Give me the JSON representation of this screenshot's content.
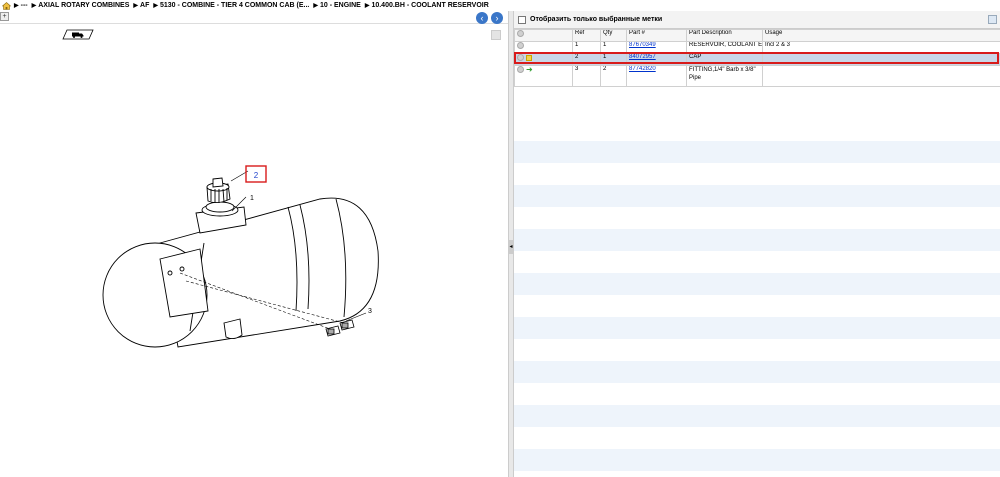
{
  "breadcrumb": {
    "items": [
      "---",
      "AXIAL ROTARY COMBINES",
      "AF",
      "5130 - COMBINE - TIER 4 COMMON CAB (E...",
      "10 - ENGINE",
      "10.400.BH - COOLANT RESERVOIR"
    ]
  },
  "drawing": {
    "callouts": [
      "1",
      "3"
    ],
    "highlighted_ref": "2"
  },
  "right_pane": {
    "filter_label": "Отобразить только выбранные метки",
    "columns": [
      "",
      "Ref",
      "Qty",
      "Part #",
      "Part Description",
      "Usage"
    ],
    "rows": [
      {
        "ref": "1",
        "qty": "1",
        "part": "87670349",
        "desc": "RESERVOIR, COOLANT E",
        "usage": "Incl 2 & 3",
        "icon": "circle"
      },
      {
        "ref": "2",
        "qty": "1",
        "part": "84072957",
        "desc": "CAP",
        "usage": "",
        "icon": "note",
        "selected": true
      },
      {
        "ref": "3",
        "qty": "2",
        "part": "87742820",
        "desc": "FITTING,1/4\" Barb x 3/8\"",
        "desc2": "Pipe",
        "usage": "",
        "icon": "arrow"
      }
    ]
  },
  "colors": {
    "accent": "#3a76c8",
    "highlight": "#d81b1b",
    "link": "#0033cc"
  }
}
